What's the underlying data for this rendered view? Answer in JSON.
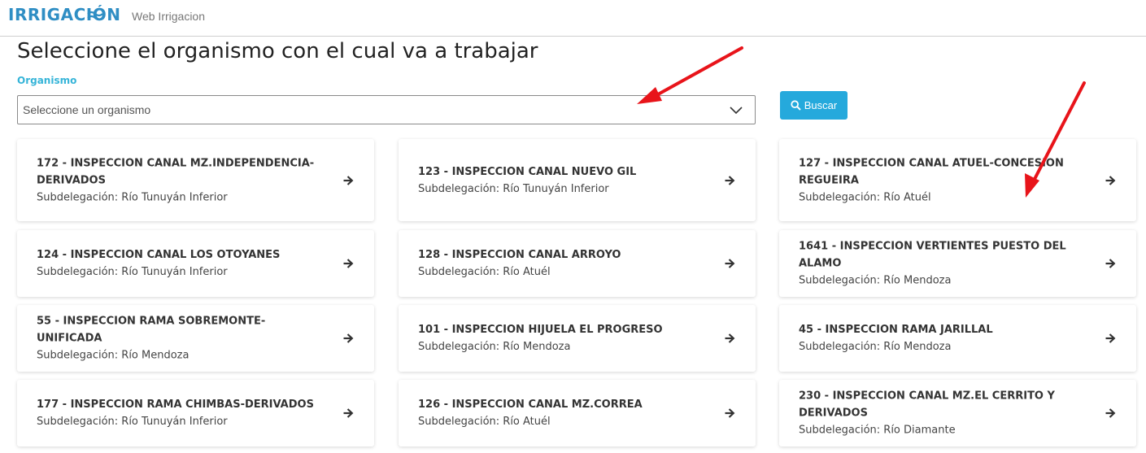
{
  "header": {
    "brand": "IRRIGACIÓN",
    "nav_link": "Web Irrigacion"
  },
  "page": {
    "title": "Seleccione el organismo con el cual va a trabajar"
  },
  "filter": {
    "label": "Organismo",
    "placeholder": "Seleccione un organismo",
    "search_button": "Buscar"
  },
  "colors": {
    "brand": "#2f8ec4",
    "accent": "#25a9dc",
    "label": "#35b4d8",
    "annotation_arrow": "#e8141a"
  },
  "cards": [
    {
      "title": "172 - INSPECCION CANAL MZ.INDEPENDENCIA-DERIVADOS",
      "subtitle": "Subdelegación: Río Tunuyán Inferior"
    },
    {
      "title": "123 - INSPECCION CANAL NUEVO GIL",
      "subtitle": "Subdelegación: Río Tunuyán Inferior"
    },
    {
      "title": "127 - INSPECCION CANAL ATUEL-CONCESION REGUEIRA",
      "subtitle": "Subdelegación: Río Atuél"
    },
    {
      "title": "124 - INSPECCION CANAL LOS OTOYANES",
      "subtitle": "Subdelegación: Río Tunuyán Inferior"
    },
    {
      "title": "128 - INSPECCION CANAL ARROYO",
      "subtitle": "Subdelegación: Río Atuél"
    },
    {
      "title": "1641 - INSPECCION VERTIENTES PUESTO DEL ALAMO",
      "subtitle": "Subdelegación: Río Mendoza"
    },
    {
      "title": "55 - INSPECCION RAMA SOBREMONTE-UNIFICADA",
      "subtitle": "Subdelegación: Río Mendoza"
    },
    {
      "title": "101 - INSPECCION HIJUELA EL PROGRESO",
      "subtitle": "Subdelegación: Río Mendoza"
    },
    {
      "title": "45 - INSPECCION RAMA JARILLAL",
      "subtitle": "Subdelegación: Río Mendoza"
    },
    {
      "title": "177 - INSPECCION RAMA CHIMBAS-DERIVADOS",
      "subtitle": "Subdelegación: Río Tunuyán Inferior"
    },
    {
      "title": "126 - INSPECCION CANAL MZ.CORREA",
      "subtitle": "Subdelegación: Río Atuél"
    },
    {
      "title": "230 - INSPECCION CANAL MZ.EL CERRITO Y DERIVADOS",
      "subtitle": "Subdelegación: Río Diamante"
    }
  ]
}
